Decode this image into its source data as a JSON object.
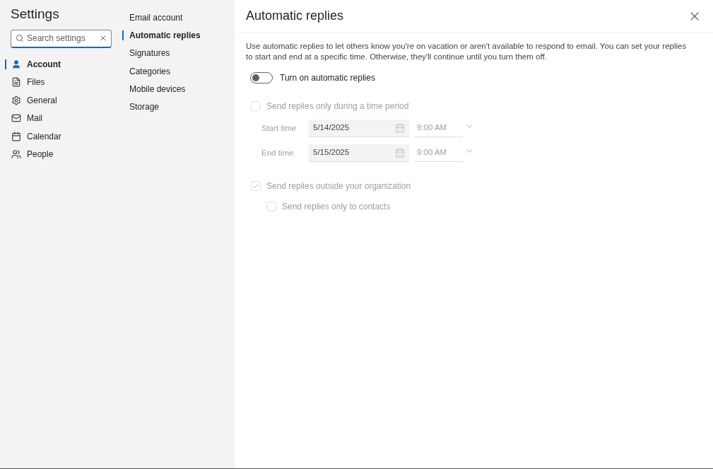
{
  "title": "Settings",
  "search": {
    "placeholder": "Search settings"
  },
  "nav": [
    {
      "label": "Account",
      "selected": true
    },
    {
      "label": "Files",
      "selected": false
    },
    {
      "label": "General",
      "selected": false
    },
    {
      "label": "Mail",
      "selected": false
    },
    {
      "label": "Calendar",
      "selected": false
    },
    {
      "label": "People",
      "selected": false
    }
  ],
  "subnav": [
    {
      "label": "Email account",
      "selected": false
    },
    {
      "label": "Automatic replies",
      "selected": true
    },
    {
      "label": "Signatures",
      "selected": false
    },
    {
      "label": "Categories",
      "selected": false
    },
    {
      "label": "Mobile devices",
      "selected": false
    },
    {
      "label": "Storage",
      "selected": false
    }
  ],
  "panel": {
    "title": "Automatic replies",
    "description": "Use automatic replies to let others know you're on vacation or aren't available to respond to email. You can set your replies to start and end at a specific time. Otherwise, they'll continue until you turn them off.",
    "toggle": {
      "label": "Turn on automatic replies",
      "on": false
    },
    "time_period": {
      "label": "Send replies only during a time period",
      "checked": false,
      "disabled": true
    },
    "times": [
      {
        "label": "Start time",
        "date": "5/14/2025",
        "time": "9:00 AM",
        "disabled": true
      },
      {
        "label": "End time",
        "date": "5/15/2025",
        "time": "9:00 AM",
        "disabled": true
      }
    ],
    "outside": {
      "label": "Send replies outside your organization",
      "checked": true,
      "disabled": true
    },
    "contacts": {
      "label": "Send replies only to contacts",
      "checked": false,
      "disabled": true
    }
  }
}
